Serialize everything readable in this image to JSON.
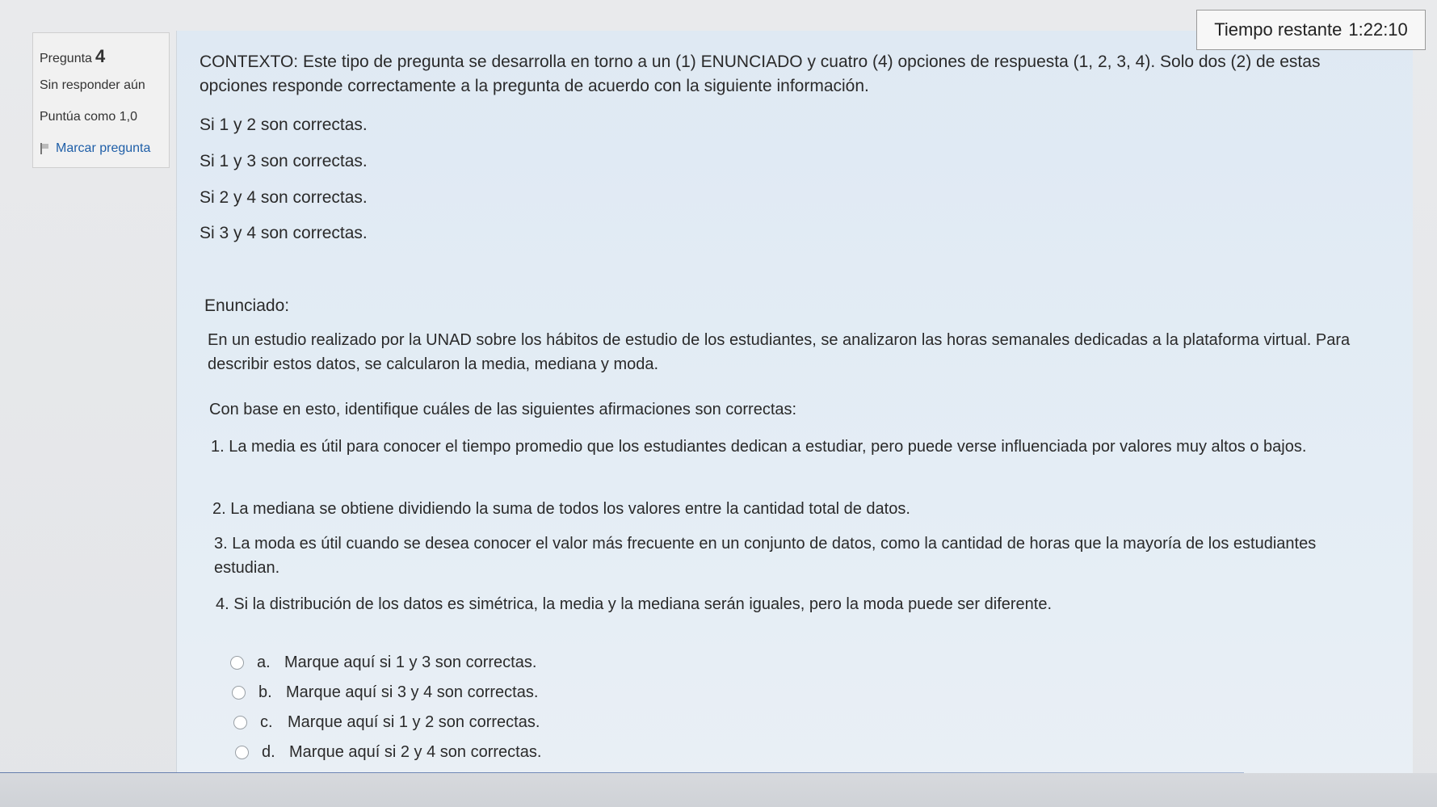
{
  "timer": {
    "label": "Tiempo restante",
    "value": "1:22:10"
  },
  "question_info": {
    "question_label": "Pregunta",
    "question_number": "4",
    "state": "Sin responder aún",
    "grade": "Puntúa como 1,0",
    "flag_label": "Marcar pregunta"
  },
  "content": {
    "context": "CONTEXTO: Este tipo de pregunta se desarrolla en torno a un (1) ENUNCIADO y cuatro (4) opciones de respuesta (1, 2, 3, 4). Solo dos (2) de estas opciones responde correctamente a la pregunta de acuerdo con la siguiente información.",
    "options_info": [
      "Si 1 y 2 son correctas.",
      "Si 1 y 3 son correctas.",
      "Si 2 y 4 son correctas.",
      "Si 3 y 4 son correctas."
    ],
    "enunciado_label": "Enunciado:",
    "statement": "En un estudio realizado por la UNAD sobre los hábitos de estudio de los estudiantes, se analizaron las horas semanales dedicadas a la plataforma virtual. Para describir estos datos, se calcularon la media, mediana y moda.",
    "base": "Con base en esto, identifique cuáles de las siguientes afirmaciones son correctas:",
    "items": [
      "1. La media es útil para conocer el tiempo promedio que los estudiantes dedican a estudiar, pero puede verse influenciada por valores muy altos o bajos.",
      "2. La mediana se obtiene dividiendo la suma de todos los valores entre la cantidad total de datos.",
      "3. La moda es útil cuando se desea conocer el valor más frecuente en un conjunto de datos, como la cantidad de horas que la mayoría de los estudiantes estudian.",
      "4. Si la distribución de los datos es simétrica, la media y la mediana serán iguales, pero la moda puede ser diferente."
    ]
  },
  "answers": [
    {
      "letter": "a.",
      "text": "Marque aquí si 1 y 3 son correctas."
    },
    {
      "letter": "b.",
      "text": "Marque aquí si 3 y 4 son correctas."
    },
    {
      "letter": "c.",
      "text": "Marque aquí si 1 y 2 son correctas."
    },
    {
      "letter": "d.",
      "text": "Marque aquí si 2 y 4 son correctas."
    }
  ]
}
